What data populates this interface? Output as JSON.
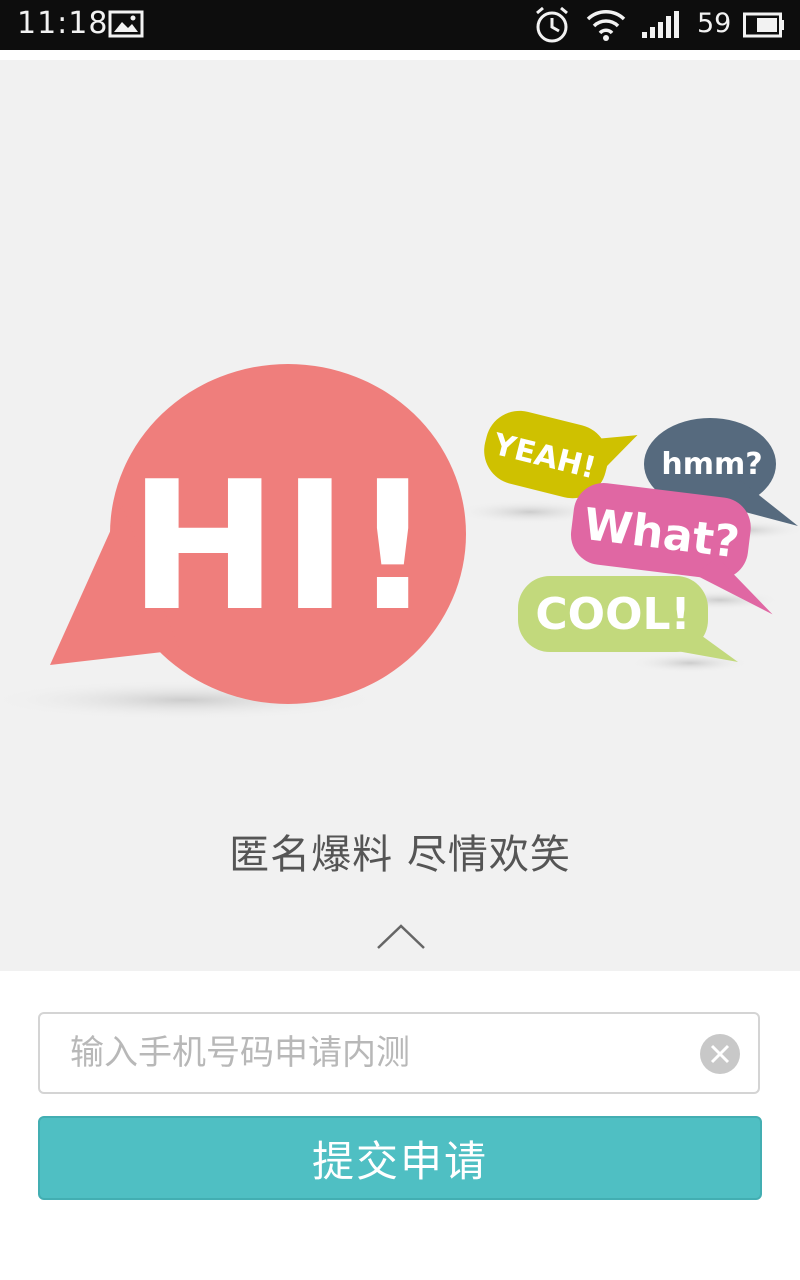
{
  "status_bar": {
    "time": "11:18",
    "battery_level": "59",
    "icons": [
      "gallery-icon",
      "alarm-icon",
      "wifi-icon",
      "signal-icon",
      "battery-icon"
    ]
  },
  "hero": {
    "bubbles": {
      "hi": "HI!",
      "yeah": "YEAH!",
      "hmm": "hmm?",
      "what": "What?",
      "cool": "COOL!"
    },
    "colors": {
      "hi": "#ef7e7c",
      "yeah": "#cfc100",
      "hmm": "#566a7e",
      "what": "#e067a3",
      "cool": "#c2d97c"
    },
    "slogan": "匿名爆料 尽情欢笑"
  },
  "form": {
    "phone_placeholder": "输入手机号码申请内测",
    "phone_value": "",
    "submit_label": "提交申请",
    "accent_color": "#4fbfc3"
  }
}
